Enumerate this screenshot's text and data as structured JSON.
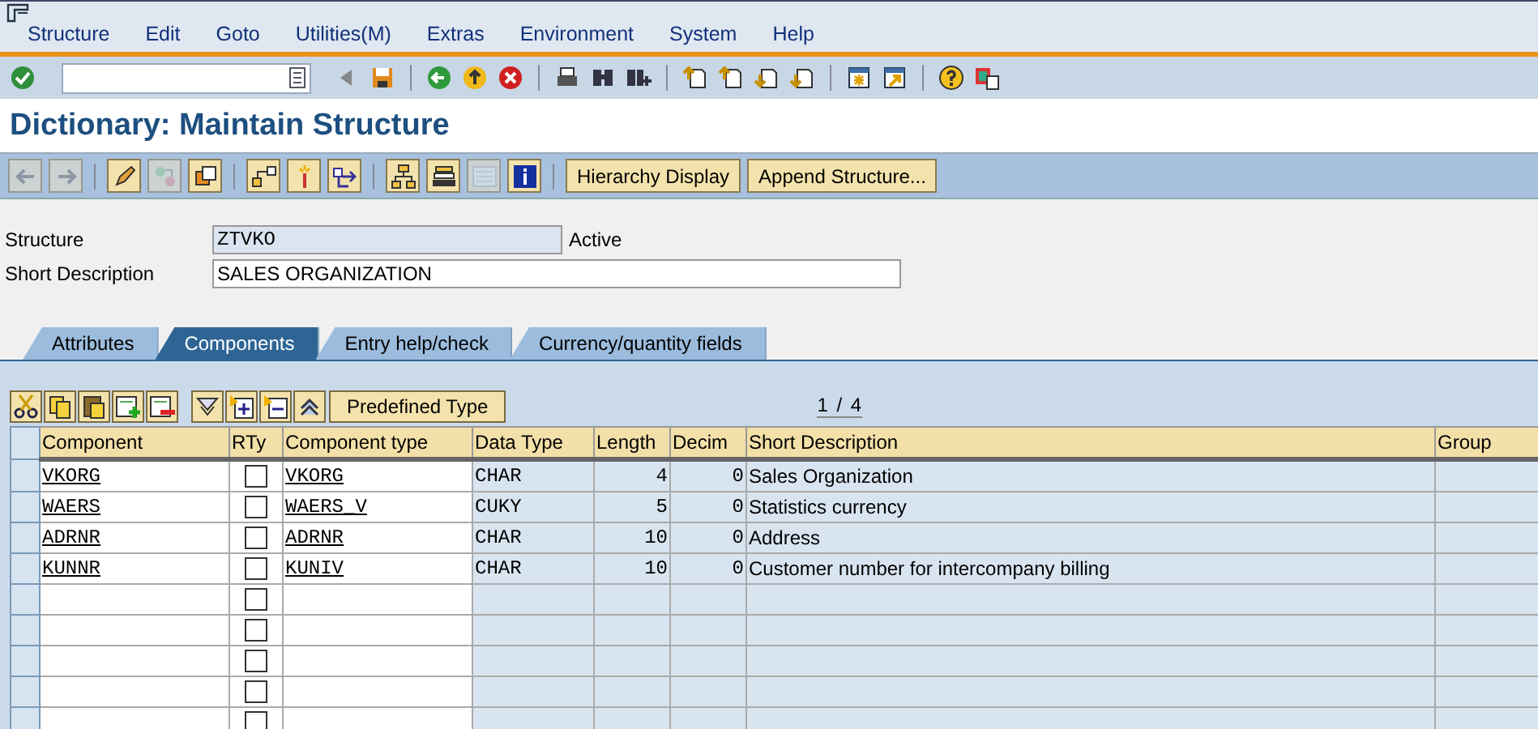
{
  "menu": [
    "Structure",
    "Edit",
    "Goto",
    "Utilities(M)",
    "Extras",
    "Environment",
    "System",
    "Help"
  ],
  "title": "Dictionary: Maintain Structure",
  "app_toolbar": {
    "icon_buttons": [
      {
        "disabled": true
      },
      {
        "disabled": true
      },
      {
        "disabled": false
      },
      {
        "disabled": true
      },
      {
        "disabled": false
      },
      {
        "disabled": false
      },
      {
        "disabled": false
      },
      {
        "disabled": false
      },
      {
        "disabled": false
      },
      {
        "disabled": false
      },
      {
        "disabled": true
      },
      {
        "disabled": false
      }
    ],
    "buttons": [
      "Hierarchy Display",
      "Append Structure..."
    ]
  },
  "form": {
    "structure_label": "Structure",
    "structure_value": "ZTVKO",
    "status": "Active",
    "description_label": "Short Description",
    "description_value": "SALES ORGANIZATION"
  },
  "tabs": [
    {
      "label": "Attributes",
      "selected": false
    },
    {
      "label": "Components",
      "selected": true
    },
    {
      "label": "Entry help/check",
      "selected": false
    },
    {
      "label": "Currency/quantity fields",
      "selected": false
    }
  ],
  "table_toolbar": {
    "buttons": [
      "Predefined Type"
    ],
    "page_indicator": "1 / 4"
  },
  "table": {
    "columns": [
      "Component",
      "RTy",
      "Component type",
      "Data Type",
      "Length",
      "Decim",
      "Short Description",
      "Group"
    ],
    "rows": [
      {
        "component": "VKORG",
        "rty_checked": false,
        "component_type": "VKORG",
        "data_type": "CHAR",
        "length": "4",
        "decimals": "0",
        "short_description": "Sales Organization"
      },
      {
        "component": "WAERS",
        "rty_checked": false,
        "component_type": "WAERS_V",
        "data_type": "CUKY",
        "length": "5",
        "decimals": "0",
        "short_description": "Statistics currency"
      },
      {
        "component": "ADRNR",
        "rty_checked": false,
        "component_type": "ADRNR",
        "data_type": "CHAR",
        "length": "10",
        "decimals": "0",
        "short_description": "Address"
      },
      {
        "component": "KUNNR",
        "rty_checked": false,
        "component_type": "KUNIV",
        "data_type": "CHAR",
        "length": "10",
        "decimals": "0",
        "short_description": "Customer number for intercompany billing"
      },
      {
        "rty_checked": false
      },
      {
        "rty_checked": false
      },
      {
        "rty_checked": false
      },
      {
        "rty_checked": false
      },
      {
        "rty_checked": false
      }
    ]
  }
}
